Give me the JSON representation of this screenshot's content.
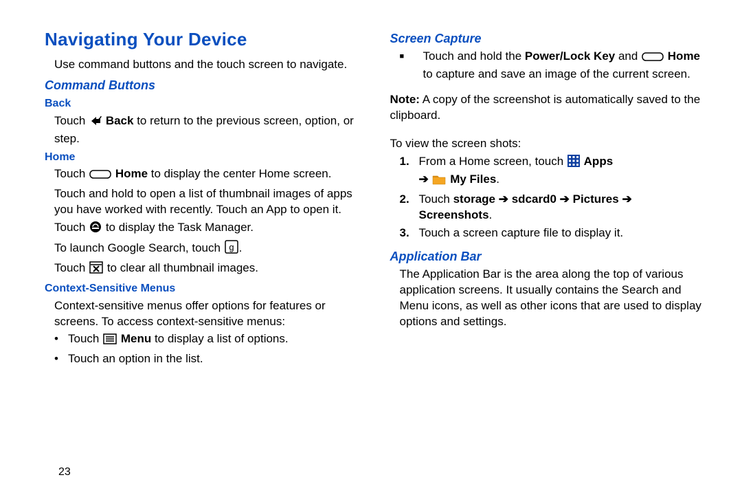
{
  "page_number": "23",
  "left": {
    "title": "Navigating Your Device",
    "intro": "Use command buttons and the touch screen to navigate.",
    "h_command": "Command Buttons",
    "back": {
      "h": "Back",
      "pre": "Touch ",
      "label": "Back",
      "post": " to return to the previous screen, option, or step."
    },
    "home": {
      "h": "Home",
      "l1_pre": "Touch ",
      "l1_label": "Home",
      "l1_post": " to display the center Home screen.",
      "l2": "Touch and hold to open a list of thumbnail images of apps you have worked with recently. Touch an App to open it.",
      "l3_pre": "Touch ",
      "l3_post": " to display the Task Manager.",
      "l4_pre": "To launch Google Search, touch ",
      "l4_post": ".",
      "l5_pre": "Touch ",
      "l5_post": " to clear all thumbnail images."
    },
    "ctx": {
      "h": "Context-Sensitive Menus",
      "p": "Context-sensitive menus offer options for features or screens. To access context-sensitive menus:",
      "b1_pre": "Touch ",
      "b1_label": "Menu",
      "b1_post": " to display a list of options.",
      "b2": "Touch an option in the list."
    }
  },
  "right": {
    "h_sc": "Screen Capture",
    "sc": {
      "pre": "Touch and hold the ",
      "k1": "Power/Lock Key",
      "mid": " and ",
      "k2": "Home",
      "post": " to capture and save an image of the current screen."
    },
    "note_label": "Note:",
    "note_body": " A copy of the screenshot is automatically saved to the clipboard.",
    "view_intro": "To view the screen shots:",
    "step1": {
      "num": "1.",
      "pre": "From a Home screen, touch ",
      "apps": "Apps",
      "arrow": " ➔ ",
      "myfiles": "My Files",
      "post": "."
    },
    "step2": {
      "num": "2.",
      "pre": "Touch ",
      "s": "storage",
      "a1": " ➔ ",
      "sd": "sdcard0",
      "a2": " ➔ ",
      "pic": "Pictures",
      "a3": " ➔ ",
      "ss": "Screenshots",
      "post": "."
    },
    "step3": {
      "num": "3.",
      "body": "Touch a screen capture file to display it."
    },
    "h_app": "Application Bar",
    "app_body": "The Application Bar is the area along the top of various application screens. It usually contains the Search and Menu icons, as well as other icons that are used to display options and settings."
  }
}
